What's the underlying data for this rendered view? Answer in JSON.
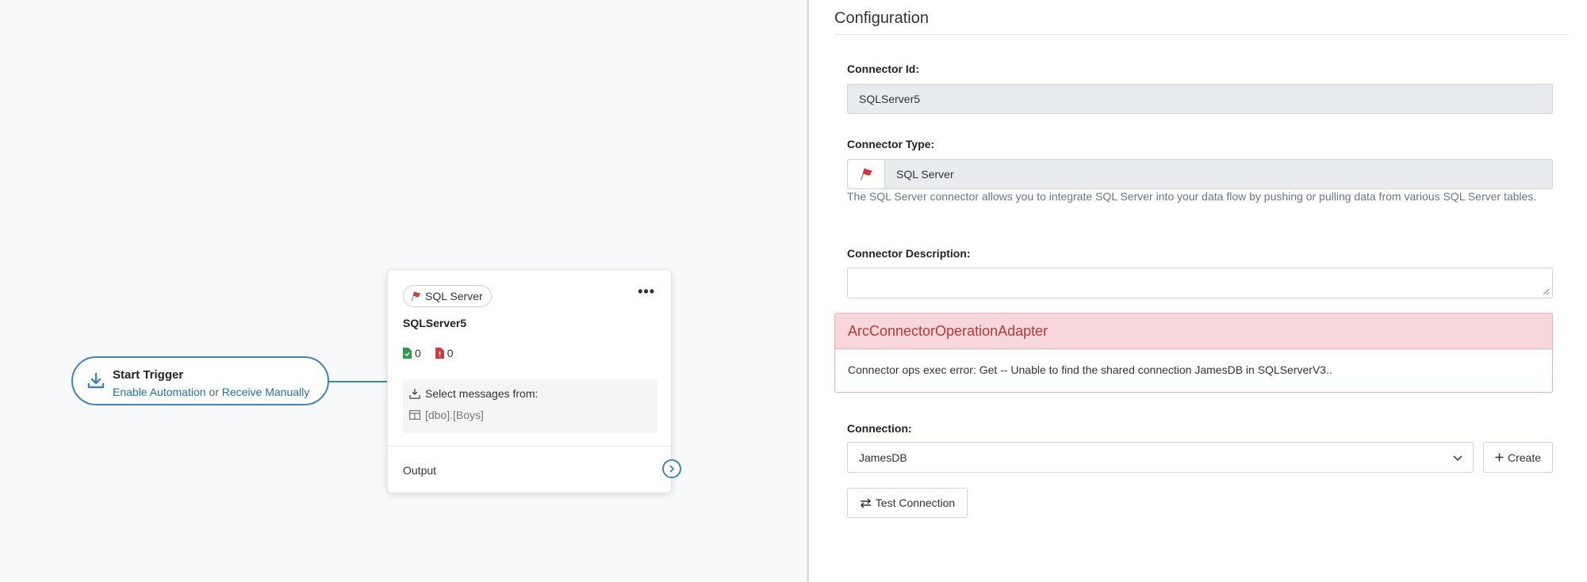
{
  "canvas": {
    "trigger": {
      "title": "Start Trigger",
      "enable_link": "Enable Automation",
      "or_text": "or",
      "receive_link": "Receive Manually"
    },
    "node": {
      "type_label": "SQL Server",
      "name": "SQLServer5",
      "success_count": "0",
      "error_count": "0",
      "select_label": "Select messages from:",
      "table_name": "[dbo].[Boys]",
      "output_label": "Output"
    }
  },
  "config": {
    "title": "Configuration",
    "connector_id_label": "Connector Id:",
    "connector_id_value": "SQLServer5",
    "connector_type_label": "Connector Type:",
    "connector_type_value": "SQL Server",
    "type_help": "The SQL Server connector allows you to integrate SQL Server into your data flow by pushing or pulling data from various SQL Server tables.",
    "description_label": "Connector Description:",
    "description_value": "",
    "alert_title": "ArcConnectorOperationAdapter",
    "alert_message": "Connector ops exec error: Get -- Unable to find the shared connection JamesDB in SQLServerV3..",
    "connection_label": "Connection:",
    "connection_value": "JamesDB",
    "create_button": "Create",
    "test_button": "Test Connection"
  },
  "colors": {
    "accent": "#3d85b8",
    "link": "#1f6fb2",
    "error_header_bg": "#f8d7da",
    "error_text": "#b23b3b",
    "readonly_bg": "#e9ecef"
  }
}
